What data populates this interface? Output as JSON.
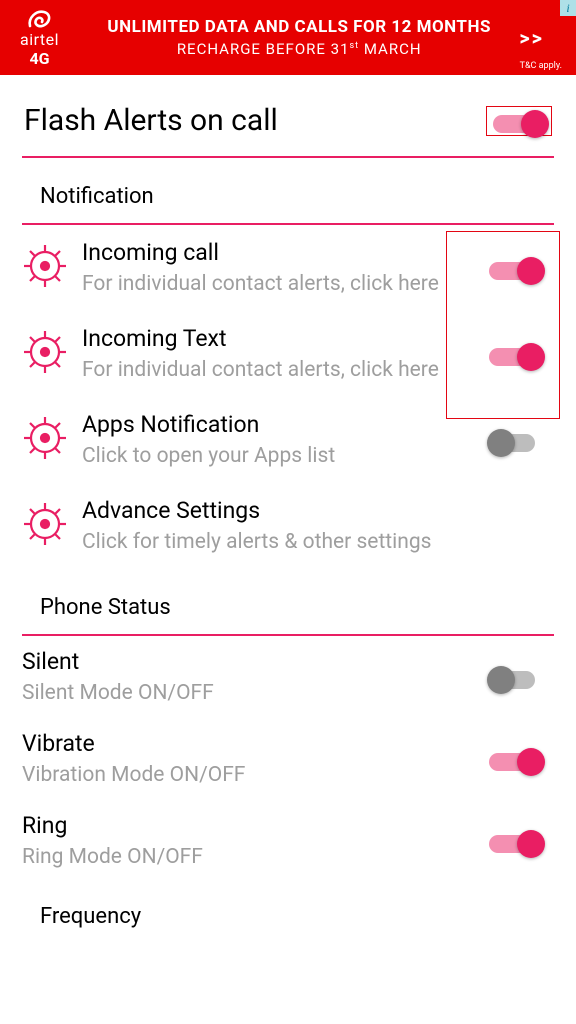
{
  "ad": {
    "brand": "airtel",
    "sub_brand": "4G",
    "line1": "UNLIMITED DATA AND CALLS FOR 12 MONTHS",
    "line2_pre": "RECHARGE BEFORE 31",
    "line2_sup": "st",
    "line2_post": " MARCH",
    "arrows": ">>",
    "tc": "T&C apply.",
    "info": "i"
  },
  "header": {
    "title": "Flash Alerts on call",
    "master_toggle_on": true
  },
  "sections": {
    "notification": {
      "label": "Notification",
      "items": [
        {
          "title": "Incoming call",
          "sub": "For individual contact alerts, click here",
          "toggle": "on"
        },
        {
          "title": "Incoming Text",
          "sub": "For individual contact alerts, click here",
          "toggle": "on"
        },
        {
          "title": "Apps Notification",
          "sub": "Click to open your Apps list",
          "toggle": "off"
        },
        {
          "title": "Advance Settings",
          "sub": "Click for timely alerts & other settings",
          "toggle": null
        }
      ]
    },
    "phone_status": {
      "label": "Phone Status",
      "items": [
        {
          "title": "Silent",
          "sub": "Silent Mode ON/OFF",
          "toggle": "off"
        },
        {
          "title": "Vibrate",
          "sub": "Vibration Mode ON/OFF",
          "toggle": "on"
        },
        {
          "title": "Ring",
          "sub": "Ring Mode ON/OFF",
          "toggle": "on"
        }
      ]
    },
    "frequency": {
      "label": "Frequency"
    }
  },
  "colors": {
    "accent": "#e91e63",
    "ad_bg": "#e60000"
  }
}
